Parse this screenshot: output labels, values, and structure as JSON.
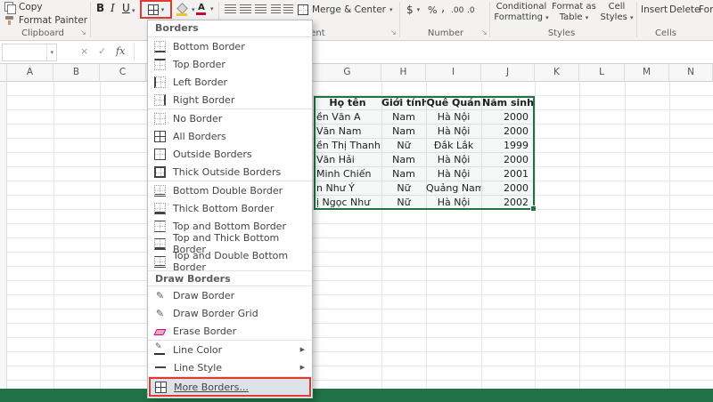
{
  "ribbon": {
    "clipboard": {
      "label": "Clipboard",
      "copy_label": "Copy",
      "format_painter_label": "Format Painter"
    },
    "font": {
      "bold_label": "B",
      "italic_label": "I",
      "underline_label": "U"
    },
    "alignment": {
      "label": "Alignment",
      "merge_center_label": "Merge & Center"
    },
    "number": {
      "label": "Number",
      "currency_label": "$",
      "percent_label": "%",
      "comma_label": ",",
      "increase_decimal_label": ".00",
      "decrease_decimal_label": ".0"
    },
    "styles": {
      "label": "Styles",
      "conditional_line1": "Conditional",
      "conditional_line2": "Formatting",
      "format_table_line1": "Format as",
      "format_table_line2": "Table",
      "cell_styles_line1": "Cell",
      "cell_styles_line2": "Styles"
    },
    "cells": {
      "label": "Cells",
      "insert_label": "Insert",
      "delete_label": "Delete",
      "format_label": "Format"
    }
  },
  "formula_bar": {
    "name_box_value": "",
    "fx_label": "fx"
  },
  "sheet": {
    "columns": [
      "A",
      "B",
      "C",
      "G",
      "H",
      "I",
      "J",
      "K",
      "L",
      "M",
      "N"
    ]
  },
  "menu": {
    "title": "Borders",
    "border_items": [
      {
        "label": "Bottom Border"
      },
      {
        "label": "Top Border"
      },
      {
        "label": "Left Border"
      },
      {
        "label": "Right Border"
      },
      {
        "label": "No Border"
      },
      {
        "label": "All Borders"
      },
      {
        "label": "Outside Borders"
      },
      {
        "label": "Thick Outside Borders"
      },
      {
        "label": "Bottom Double Border"
      },
      {
        "label": "Thick Bottom Border"
      },
      {
        "label": "Top and Bottom Border"
      },
      {
        "label": "Top and Thick Bottom Border"
      },
      {
        "label": "Top and Double Bottom Border"
      }
    ],
    "draw_title": "Draw Borders",
    "draw_items": [
      {
        "label": "Draw Border"
      },
      {
        "label": "Draw Border Grid"
      },
      {
        "label": "Erase Border"
      }
    ],
    "submenu_items": [
      {
        "label": "Line Color"
      },
      {
        "label": "Line Style"
      }
    ],
    "more_label": "More Borders..."
  },
  "table": {
    "headers": {
      "name": "Họ tên",
      "gender": "Giới tính",
      "hometown": "Quê Quán",
      "birth_year": "Năm sinh"
    },
    "rows": [
      {
        "name": "ền Văn A",
        "gender": "Nam",
        "hometown": "Hà Nội",
        "year": "2000"
      },
      {
        "name": "Văn Nam",
        "gender": "Nam",
        "hometown": "Hà Nội",
        "year": "2000"
      },
      {
        "name": "ền Thị Thanh",
        "gender": "Nữ",
        "hometown": "Đắk Lắk",
        "year": "1999"
      },
      {
        "name": "Văn Hải",
        "gender": "Nam",
        "hometown": "Hà Nội",
        "year": "2000"
      },
      {
        "name": "Minh Chiến",
        "gender": "Nam",
        "hometown": "Hà Nội",
        "year": "2001"
      },
      {
        "name": "n Như Ý",
        "gender": "Nữ",
        "hometown": "Quảng Nam",
        "year": "2000"
      },
      {
        "name": "ị Ngọc Như",
        "gender": "Nữ",
        "hometown": "Hà Nội",
        "year": "2002"
      }
    ]
  },
  "icons": {
    "dropdown_arrow": "▾",
    "submenu_arrow": "▶",
    "pencil": "✎",
    "check": "✓",
    "cancel": "×",
    "launcher_arrow": "↘"
  },
  "colors": {
    "excel_green": "#1F7246",
    "selection_green": "#217346",
    "highlight_red": "#E0392F"
  }
}
